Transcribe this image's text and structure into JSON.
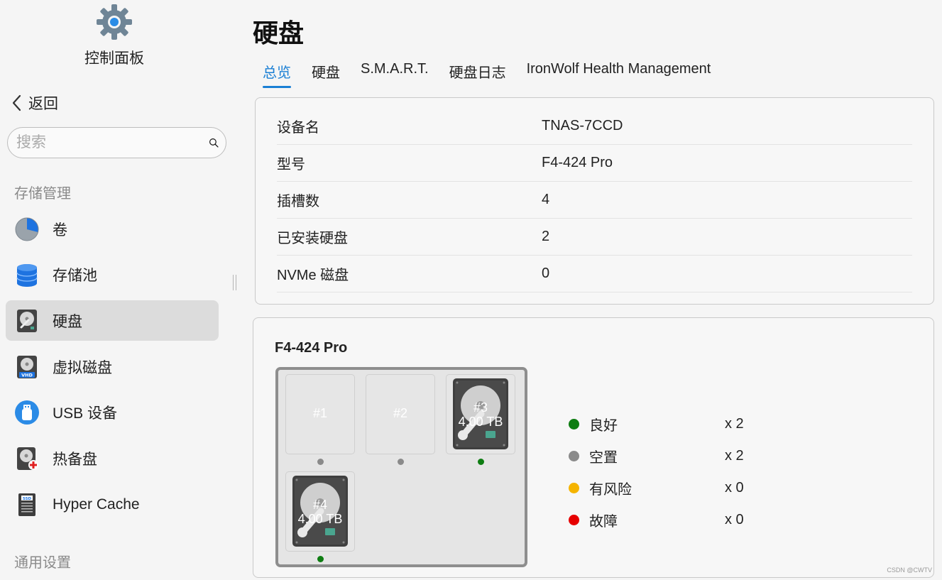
{
  "sidebar": {
    "app_title": "控制面板",
    "back_label": "返回",
    "search_placeholder": "搜索",
    "section_storage": "存储管理",
    "section_general": "通用设置",
    "items": [
      {
        "label": "卷",
        "icon": "volume-pie-icon"
      },
      {
        "label": "存储池",
        "icon": "storage-pool-icon"
      },
      {
        "label": "硬盘",
        "icon": "hard-disk-icon",
        "active": true
      },
      {
        "label": "虚拟磁盘",
        "icon": "virtual-disk-vhd-icon"
      },
      {
        "label": "USB 设备",
        "icon": "usb-device-icon"
      },
      {
        "label": "热备盘",
        "icon": "hot-spare-disk-icon"
      },
      {
        "label": "Hyper Cache",
        "icon": "ssd-cache-icon"
      }
    ]
  },
  "main": {
    "title": "硬盘",
    "tabs": [
      {
        "label": "总览",
        "active": true
      },
      {
        "label": "硬盘"
      },
      {
        "label": "S.M.A.R.T."
      },
      {
        "label": "硬盘日志"
      },
      {
        "label": "IronWolf Health Management"
      }
    ],
    "info": [
      {
        "key": "设备名",
        "value": "TNAS-7CCD"
      },
      {
        "key": "型号",
        "value": "F4-424 Pro"
      },
      {
        "key": "插槽数",
        "value": "4"
      },
      {
        "key": "已安装硬盘",
        "value": "2"
      },
      {
        "key": "NVMe 磁盘",
        "value": "0"
      }
    ],
    "bay": {
      "model": "F4-424 Pro",
      "slots": [
        {
          "label": "#1",
          "installed": false,
          "capacity": "",
          "status": "empty"
        },
        {
          "label": "#2",
          "installed": false,
          "capacity": "",
          "status": "empty"
        },
        {
          "label": "#3",
          "installed": true,
          "capacity": "4.00 TB",
          "status": "good"
        },
        {
          "label": "#4",
          "installed": true,
          "capacity": "4.00 TB",
          "status": "good"
        }
      ],
      "legend": [
        {
          "label": "良好",
          "count": "x 2",
          "color": "#0e7d12"
        },
        {
          "label": "空置",
          "count": "x 2",
          "color": "#8a8a8a"
        },
        {
          "label": "有风险",
          "count": "x 0",
          "color": "#f5b400"
        },
        {
          "label": "故障",
          "count": "x 0",
          "color": "#e60000"
        }
      ]
    }
  },
  "colors": {
    "accent": "#1a7fd4",
    "good": "#0e7d12",
    "empty": "#8a8a8a",
    "risk": "#f5b400",
    "fault": "#e60000"
  },
  "watermark": "CSDN @CWTV"
}
